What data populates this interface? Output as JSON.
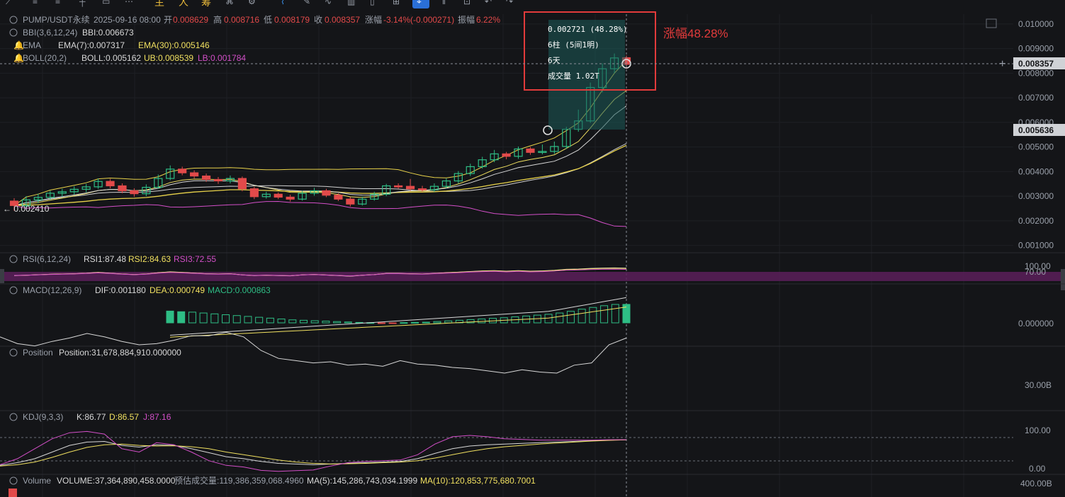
{
  "toolbar": {
    "draw_labels": [
      "主",
      "人",
      "筹"
    ]
  },
  "header": {
    "symbol": "PUMP/USDT永续",
    "datetime": "2025-09-16 08:00",
    "open_label": "开",
    "open": "0.008629",
    "high_label": "高",
    "high": "0.008716",
    "low_label": "低",
    "low": "0.008179",
    "close_label": "收",
    "close": "0.008357",
    "change_label": "涨幅",
    "change": "-3.14%(-0.000271)",
    "amp_label": "振幅",
    "amp": "6.22%"
  },
  "indicators": {
    "bbi": {
      "name": "BBI(3,6,12,24)",
      "value": "BBI:0.006673"
    },
    "ema": {
      "name": "EMA",
      "ema7": "EMA(7):0.007317",
      "ema30": "EMA(30):0.005146"
    },
    "boll": {
      "name": "BOLL(20,2)",
      "boll": "BOLL:0.005162",
      "ub": "UB:0.008539",
      "lb": "LB:0.001784"
    },
    "rsi": {
      "name": "RSI(6,12,24)",
      "rsi1": "RSI1:87.48",
      "rsi2": "RSI2:84.63",
      "rsi3": "RSI3:72.55"
    },
    "macd": {
      "name": "MACD(12,26,9)",
      "dif": "DIF:0.001180",
      "dea": "DEA:0.000749",
      "macd": "MACD:0.000863"
    },
    "position": {
      "name": "Position",
      "value": "Position:31,678,884,910.000000"
    },
    "kdj": {
      "name": "KDJ(9,3,3)",
      "k": "K:86.77",
      "d": "D:86.57",
      "j": "J:87.16"
    },
    "volume": {
      "name": "Volume",
      "value": "VOLUME:37,364,890,458.0000",
      "est": "预估成交量:119,386,359,068.4960",
      "ma5": "MA(5):145,286,743,034.1999",
      "ma10": "MA(10):120,853,775,680.7001"
    }
  },
  "measure": {
    "line1": "0.002721 (48.28%)",
    "line2": "6柱 (5间1明)",
    "line3": "6天",
    "line4": "成交量 1.02T",
    "annotation": "涨幅48.28%"
  },
  "low_marker": "← 0.002410",
  "price_labels": {
    "current": "0.008357",
    "measure_start": "0.005636"
  },
  "axes": {
    "price_ticks": [
      "0.010000",
      "0.009000",
      "0.008000",
      "0.007000",
      "0.006000",
      "0.005000",
      "0.004000",
      "0.003000",
      "0.002000",
      "0.001000"
    ],
    "rsi_ticks": [
      "100.00",
      "70.00"
    ],
    "macd_tick": "0.000000",
    "position_tick": "30.00B",
    "kdj_ticks": [
      "100.00",
      "0.00"
    ],
    "volume_tick": "400.00B"
  },
  "colors": {
    "up": "#2ebd85",
    "down": "#e24a4a",
    "ema7": "#f0e060",
    "ema30": "#e8d24a",
    "bbi": "#d8d8d8",
    "ub": "#e8d24a",
    "lb": "#d34fc8",
    "mid": "#cfcfcf",
    "annotation": "#e23b3b"
  },
  "chart_data": {
    "type": "candlestick",
    "ylim": [
      0.0007,
      0.0104
    ],
    "candles": [
      {
        "o": 0.0028,
        "c": 0.00262,
        "h": 0.00292,
        "l": 0.00241
      },
      {
        "o": 0.00262,
        "c": 0.00285,
        "h": 0.003,
        "l": 0.0025
      },
      {
        "o": 0.00285,
        "c": 0.00295,
        "h": 0.0031,
        "l": 0.00272
      },
      {
        "o": 0.00295,
        "c": 0.00312,
        "h": 0.00322,
        "l": 0.00285
      },
      {
        "o": 0.00312,
        "c": 0.00318,
        "h": 0.0033,
        "l": 0.00298
      },
      {
        "o": 0.00318,
        "c": 0.00328,
        "h": 0.0034,
        "l": 0.00306
      },
      {
        "o": 0.00328,
        "c": 0.00338,
        "h": 0.0035,
        "l": 0.00316
      },
      {
        "o": 0.00338,
        "c": 0.0036,
        "h": 0.00372,
        "l": 0.0033
      },
      {
        "o": 0.0036,
        "c": 0.00342,
        "h": 0.0037,
        "l": 0.00332
      },
      {
        "o": 0.00342,
        "c": 0.00322,
        "h": 0.00352,
        "l": 0.00312
      },
      {
        "o": 0.00322,
        "c": 0.0031,
        "h": 0.00332,
        "l": 0.00298
      },
      {
        "o": 0.0031,
        "c": 0.00336,
        "h": 0.00348,
        "l": 0.003
      },
      {
        "o": 0.00336,
        "c": 0.00372,
        "h": 0.00388,
        "l": 0.0033
      },
      {
        "o": 0.00372,
        "c": 0.0041,
        "h": 0.00425,
        "l": 0.00365
      },
      {
        "o": 0.0041,
        "c": 0.00395,
        "h": 0.0042,
        "l": 0.00385
      },
      {
        "o": 0.00395,
        "c": 0.00382,
        "h": 0.00405,
        "l": 0.00372
      },
      {
        "o": 0.00382,
        "c": 0.00368,
        "h": 0.00392,
        "l": 0.00358
      },
      {
        "o": 0.00368,
        "c": 0.00362,
        "h": 0.00378,
        "l": 0.0035
      },
      {
        "o": 0.00362,
        "c": 0.00372,
        "h": 0.00384,
        "l": 0.00352
      },
      {
        "o": 0.00372,
        "c": 0.0033,
        "h": 0.0038,
        "l": 0.0032
      },
      {
        "o": 0.0033,
        "c": 0.00298,
        "h": 0.00338,
        "l": 0.00288
      },
      {
        "o": 0.00298,
        "c": 0.00308,
        "h": 0.00318,
        "l": 0.0029
      },
      {
        "o": 0.00308,
        "c": 0.00296,
        "h": 0.00315,
        "l": 0.00288
      },
      {
        "o": 0.00296,
        "c": 0.00288,
        "h": 0.00306,
        "l": 0.00278
      },
      {
        "o": 0.00288,
        "c": 0.00312,
        "h": 0.00322,
        "l": 0.00282
      },
      {
        "o": 0.00312,
        "c": 0.00322,
        "h": 0.00334,
        "l": 0.00302
      },
      {
        "o": 0.00322,
        "c": 0.00304,
        "h": 0.0033,
        "l": 0.00296
      },
      {
        "o": 0.00304,
        "c": 0.00288,
        "h": 0.00312,
        "l": 0.0028
      },
      {
        "o": 0.00288,
        "c": 0.00268,
        "h": 0.00296,
        "l": 0.00258
      },
      {
        "o": 0.00268,
        "c": 0.00288,
        "h": 0.00298,
        "l": 0.00262
      },
      {
        "o": 0.00288,
        "c": 0.00308,
        "h": 0.00318,
        "l": 0.00282
      },
      {
        "o": 0.00308,
        "c": 0.00342,
        "h": 0.0035,
        "l": 0.003
      },
      {
        "o": 0.00342,
        "c": 0.0034,
        "h": 0.00352,
        "l": 0.0033
      },
      {
        "o": 0.0034,
        "c": 0.0033,
        "h": 0.0037,
        "l": 0.00322
      },
      {
        "o": 0.0033,
        "c": 0.00326,
        "h": 0.00342,
        "l": 0.00318
      },
      {
        "o": 0.00326,
        "c": 0.0034,
        "h": 0.00352,
        "l": 0.00318
      },
      {
        "o": 0.0034,
        "c": 0.00362,
        "h": 0.00372,
        "l": 0.00332
      },
      {
        "o": 0.00362,
        "c": 0.00392,
        "h": 0.00402,
        "l": 0.00352
      },
      {
        "o": 0.00392,
        "c": 0.0042,
        "h": 0.00432,
        "l": 0.00382
      },
      {
        "o": 0.0042,
        "c": 0.00448,
        "h": 0.0046,
        "l": 0.00412
      },
      {
        "o": 0.00448,
        "c": 0.00472,
        "h": 0.00488,
        "l": 0.00438
      },
      {
        "o": 0.00472,
        "c": 0.00462,
        "h": 0.0048,
        "l": 0.0045
      },
      {
        "o": 0.00462,
        "c": 0.00492,
        "h": 0.00502,
        "l": 0.00452
      },
      {
        "o": 0.00492,
        "c": 0.00478,
        "h": 0.005,
        "l": 0.00468
      },
      {
        "o": 0.00478,
        "c": 0.00482,
        "h": 0.0051,
        "l": 0.0047
      },
      {
        "o": 0.00482,
        "c": 0.00502,
        "h": 0.00522,
        "l": 0.00472
      },
      {
        "o": 0.00502,
        "c": 0.00572,
        "h": 0.00582,
        "l": 0.00492
      },
      {
        "o": 0.00572,
        "c": 0.00606,
        "h": 0.00652,
        "l": 0.00562
      },
      {
        "o": 0.00606,
        "c": 0.00742,
        "h": 0.00762,
        "l": 0.00598
      },
      {
        "o": 0.00742,
        "c": 0.00818,
        "h": 0.0084,
        "l": 0.00722
      },
      {
        "o": 0.00818,
        "c": 0.00862,
        "h": 0.0088,
        "l": 0.008
      },
      {
        "o": 0.00863,
        "c": 0.00836,
        "h": 0.00872,
        "l": 0.00818
      }
    ],
    "rsi": {
      "ylim": [
        0,
        100
      ],
      "values": [
        40,
        42,
        45,
        48,
        50,
        52,
        55,
        60,
        55,
        50,
        46,
        50,
        58,
        64,
        60,
        56,
        52,
        50,
        52,
        44,
        40,
        42,
        40,
        38,
        44,
        47,
        43,
        40,
        36,
        42,
        46,
        54,
        54,
        52,
        50,
        54,
        58,
        62,
        66,
        70,
        72,
        68,
        72,
        68,
        70,
        74,
        80,
        82,
        86,
        88,
        89,
        87.48
      ]
    },
    "macd": {
      "ylim": [
        -0.0004,
        0.0014
      ],
      "bars": [
        0.00055,
        0.00052,
        0.0005,
        0.00046,
        0.00042,
        0.00038,
        0.00034,
        0.0003,
        0.00026,
        0.00022,
        0.00018,
        0.00014,
        0.00012,
        0.0001,
        8e-05,
        6e-05,
        4e-05,
        2e-05,
        1e-05,
        -1e-05,
        -2e-05,
        1e-05,
        2e-05,
        3e-05,
        6e-05,
        9e-05,
        0.00012,
        0.00015,
        0.00018,
        0.00021,
        0.00024,
        0.00028,
        0.00032,
        0.00036,
        0.0004,
        0.00046,
        0.00054,
        0.00064,
        0.00072,
        0.0008,
        0.00086,
        0.000863
      ]
    },
    "position": {
      "values": [
        34.2,
        33.6,
        33.4,
        33.8,
        34.1,
        34.5,
        34.2,
        33.8,
        33.5,
        33.6,
        33.9,
        34.3,
        34.3,
        34.6,
        34.2,
        33.0,
        32.3,
        32.1,
        31.9,
        32.0,
        31.7,
        31.8,
        31.6,
        32.1,
        31.8,
        31.7,
        31.5,
        31.4,
        31.2,
        31.0,
        31.3,
        31.1,
        31.0,
        31.7,
        31.9,
        33.5,
        34.1
      ]
    },
    "kdj": {
      "ylim": [
        -20,
        110
      ],
      "k": [
        10,
        18,
        30,
        50,
        70,
        80,
        82,
        70,
        65,
        72,
        70,
        60,
        48,
        36,
        30,
        22,
        16,
        14,
        12,
        14,
        16,
        18,
        20,
        22,
        30,
        46,
        60,
        68,
        72,
        74,
        76,
        78,
        80,
        82,
        84,
        86,
        86.77
      ],
      "d": [
        8,
        12,
        20,
        34,
        50,
        64,
        72,
        74,
        70,
        68,
        69,
        66,
        60,
        50,
        42,
        34,
        26,
        20,
        16,
        14,
        15,
        16,
        18,
        20,
        24,
        32,
        42,
        52,
        60,
        66,
        70,
        74,
        77,
        80,
        83,
        85,
        86.57
      ],
      "j": [
        12,
        30,
        60,
        90,
        108,
        112,
        104,
        60,
        50,
        78,
        72,
        50,
        24,
        10,
        5,
        -5,
        -8,
        -6,
        -4,
        8,
        18,
        22,
        24,
        26,
        42,
        74,
        96,
        100,
        96,
        90,
        88,
        86,
        86,
        86,
        86,
        87,
        87.16
      ]
    }
  }
}
